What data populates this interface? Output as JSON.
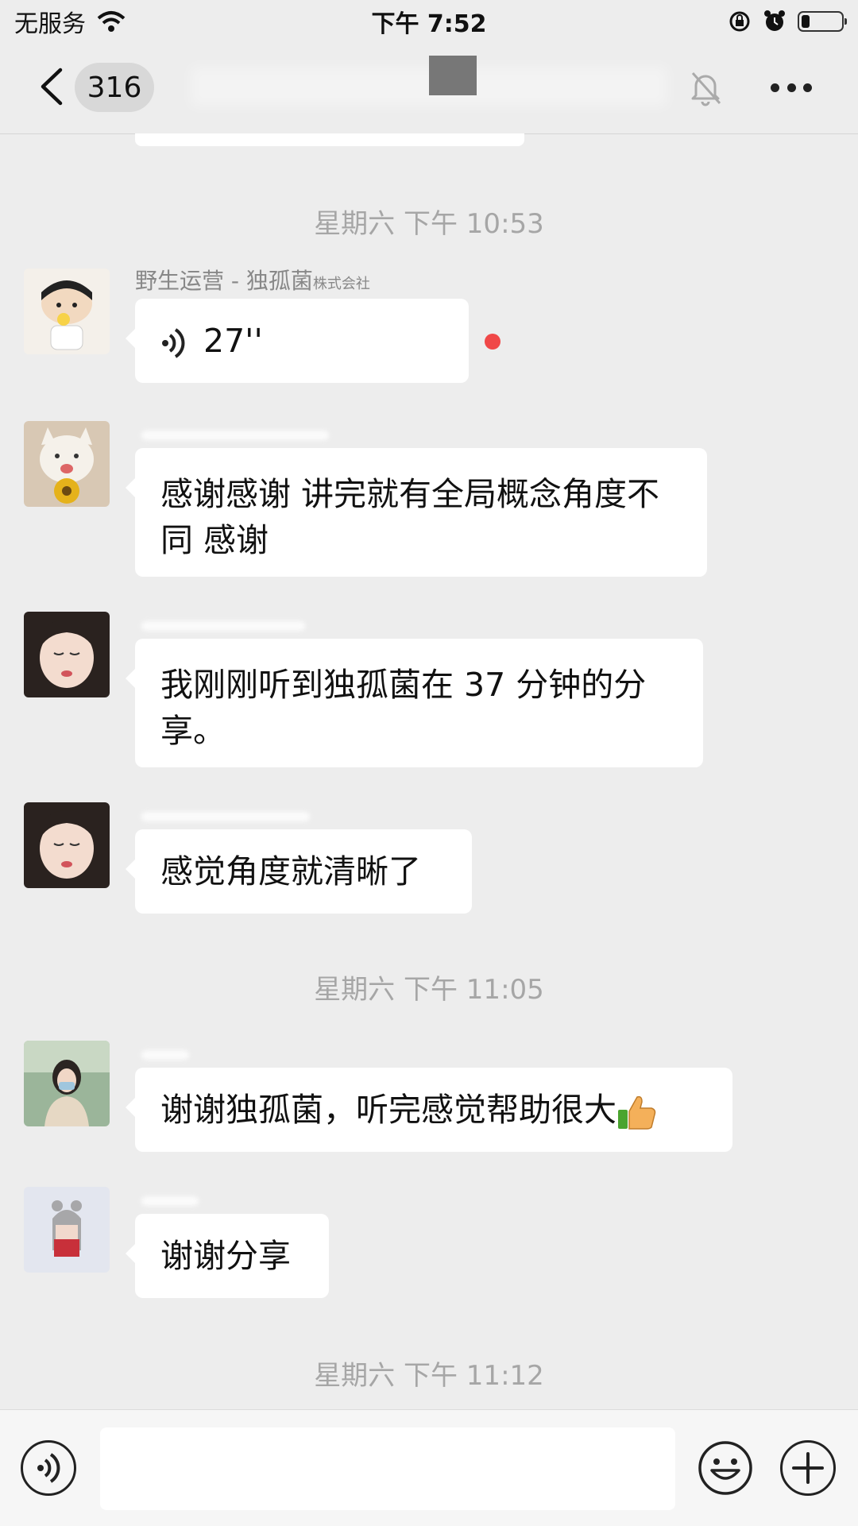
{
  "status_bar": {
    "carrier": "无服务",
    "time": "下午 7:52",
    "icons": [
      "wifi-icon",
      "orientation-lock-icon",
      "alarm-icon",
      "battery-icon"
    ]
  },
  "nav": {
    "unread_count": "316",
    "icons": [
      "back-icon",
      "mute-icon",
      "more-icon"
    ]
  },
  "messages": [
    {
      "type": "timestamp",
      "text": "星期六 下午 10:53"
    },
    {
      "type": "voice",
      "sender": "野生运营 - 独孤菌",
      "sender_tag": "株式会社",
      "duration": "27''",
      "unread": true
    },
    {
      "type": "text",
      "text": "感谢感谢  讲完就有全局概念角度不同 感谢"
    },
    {
      "type": "text",
      "text": "我刚刚听到独孤菌在 37 分钟的分享。"
    },
    {
      "type": "text",
      "text": "感觉角度就清晰了"
    },
    {
      "type": "timestamp",
      "text": "星期六 下午 11:05"
    },
    {
      "type": "text",
      "text": "谢谢独孤菌，听完感觉帮助很大",
      "emoji": "thumbs-up-icon"
    },
    {
      "type": "text",
      "text": "谢谢分享"
    },
    {
      "type": "timestamp",
      "text": "星期六 下午 11:12"
    }
  ],
  "input_bar": {
    "placeholder": "",
    "icons": [
      "voice-input-icon",
      "emoji-icon",
      "plus-icon"
    ]
  },
  "colors": {
    "background": "#ededed",
    "bubble": "#ffffff",
    "unread_dot": "#f04848",
    "timestamp": "#a6a6a6"
  }
}
